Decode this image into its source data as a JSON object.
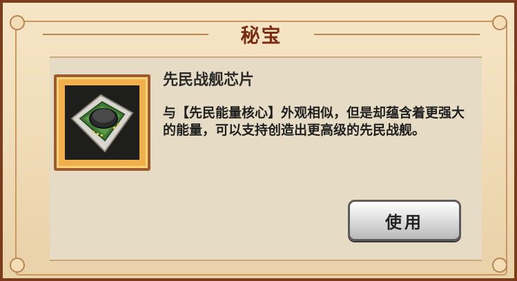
{
  "dialog": {
    "title": "秘宝"
  },
  "item": {
    "name": "先民战舰芯片",
    "icon": "ancient-warship-chip-icon",
    "description": "与【先民能量核心】外观相似，但是却蕴含着更强大的能量，可以支持创造出更高级的先民战舰。"
  },
  "actions": {
    "use_label": "使用"
  },
  "colors": {
    "title": "#7a2d12",
    "frame": "#7a3c1a",
    "icon_border": "#9c5a2d",
    "icon_bg": "#f0b14d"
  }
}
